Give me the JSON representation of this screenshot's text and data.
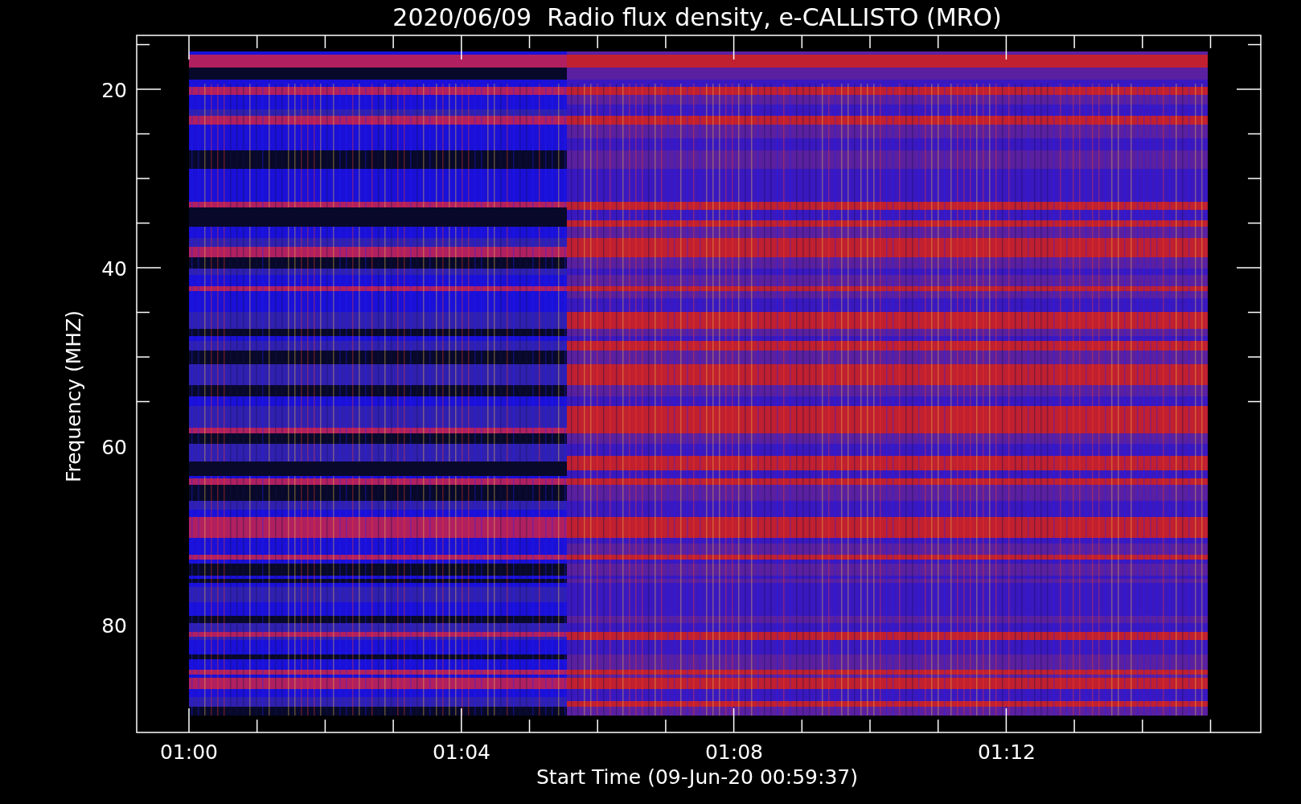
{
  "title": "2020/06/09  Radio flux density, e-CALLISTO (MRO)",
  "y_axis": {
    "label": "Frequency (MHZ)",
    "ticks": [
      "20",
      "40",
      "60",
      "80"
    ]
  },
  "x_axis": {
    "label": "Start Time (09-Jun-20 00:59:37)",
    "ticks": [
      "01:00",
      "01:04",
      "01:08",
      "01:12"
    ]
  }
}
